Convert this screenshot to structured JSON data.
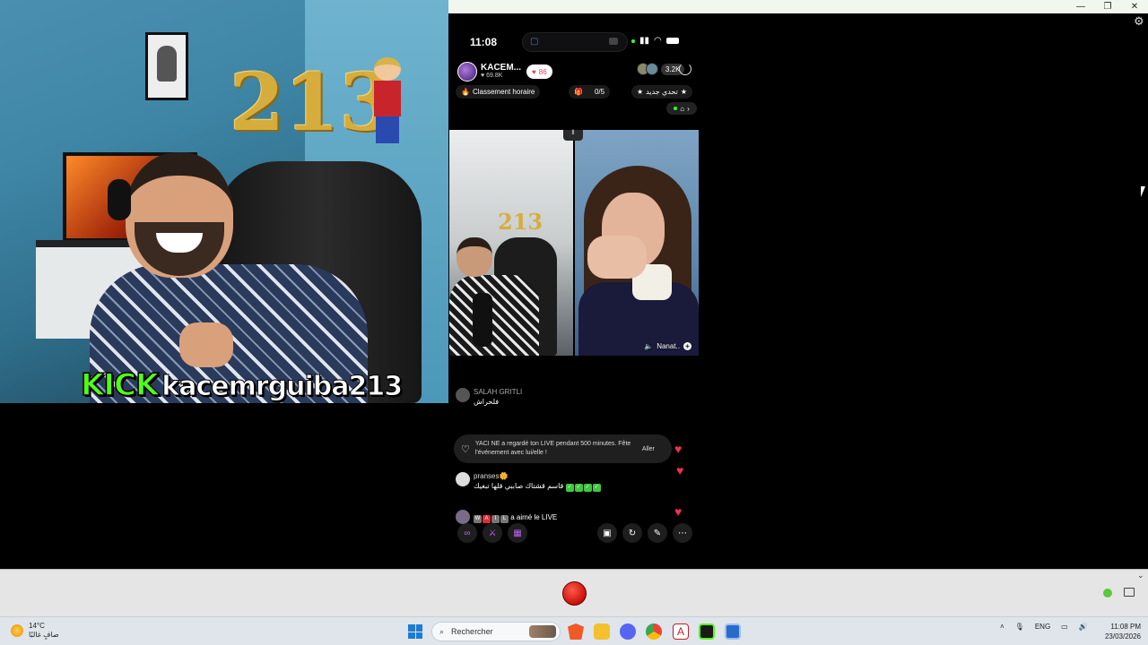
{
  "webcam": {
    "wall_number": "213",
    "kick_logo": "KICK",
    "username": "kacemrguiba213"
  },
  "window": {
    "minimize_glyph": "—",
    "maximize_glyph": "❐",
    "close_glyph": "✕",
    "settings_glyph": "⚙"
  },
  "phone": {
    "status": {
      "time": "11:08"
    },
    "host": {
      "name": "KACEM...",
      "followers": "69.8K",
      "likes": "86",
      "viewer_count": "3.2K"
    },
    "tags": {
      "ranking": "Classement horaire",
      "progress": "0/5",
      "third": "تحدي جديد"
    },
    "video": {
      "mini_number": "213",
      "audio_toggle": "⫴",
      "guest_name": "Nanat..",
      "guest_plus": "+"
    },
    "chat": {
      "msg1_name": "SALAH GRITLI",
      "msg1_text": "فلحراش",
      "notify_text": "YACI NE a regardé ton LIVE pendant 500 minutes. Fête l'événement avec lui/elle !",
      "notify_button": "Aller",
      "msg2_name": "pranses🌼",
      "msg2_text": "قاسم قشتاك صاببي قلها تبغيك",
      "msg3_text": "a aimé le LIVE"
    }
  },
  "taskbar": {
    "weather_temp": "14°C",
    "weather_desc": "صافٍ غالبًا",
    "search_placeholder": "Rechercher",
    "language": "ENG",
    "time": "11:08 PM",
    "date": "23/03/2026"
  },
  "colors": {
    "kick_green": "#53fc18",
    "heart_red": "#f0304a",
    "record_red": "#e0201a",
    "taskbar_bg": "#dfe5ea"
  }
}
